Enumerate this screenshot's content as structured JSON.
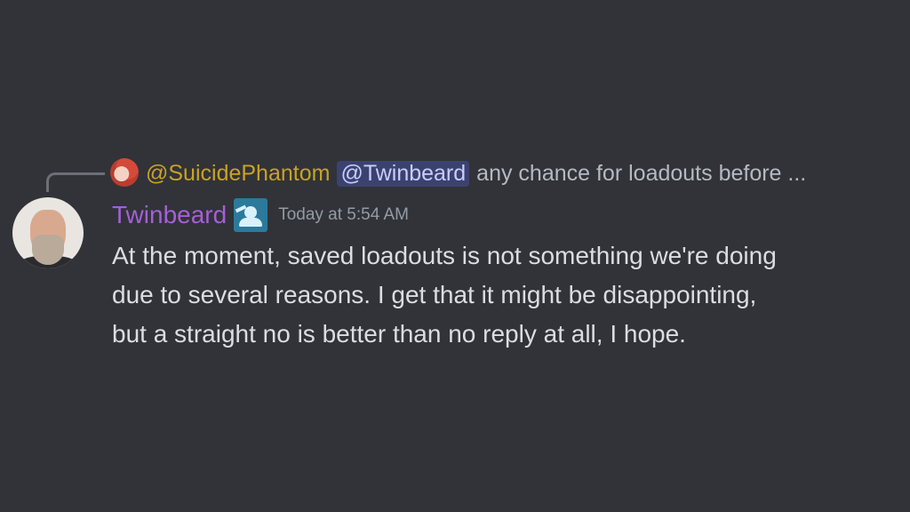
{
  "reply": {
    "author": "@SuicidePhantom",
    "mention": "@Twinbeard",
    "preview": "any chance for loadouts before ..."
  },
  "message": {
    "author": "Twinbeard",
    "role_icon": "user-wings-icon",
    "timestamp": "Today at 5:54 AM",
    "lines": [
      "At the moment, saved loadouts is not something we're doing",
      "due to several reasons. I get that it might be disappointing,",
      "but a straight no is better than no reply at all, I hope."
    ]
  },
  "colors": {
    "background": "#313338",
    "reply_author": "#c9a227",
    "mention_bg": "#3c4270",
    "mention_text": "#c9cdfb",
    "username": "#a55fd8",
    "body_text": "#dbdee1",
    "timestamp": "#949ba4"
  }
}
